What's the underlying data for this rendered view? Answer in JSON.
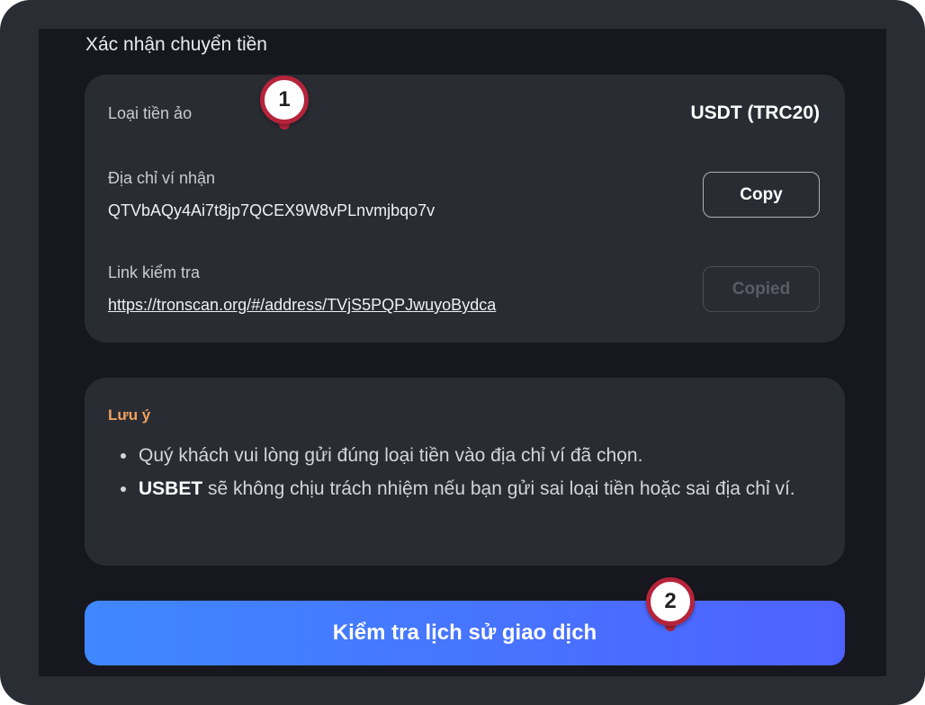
{
  "page": {
    "title": "Xác nhận chuyển tiền"
  },
  "transfer": {
    "coin_label": "Loại tiền ảo",
    "coin_value": "USDT (TRC20)",
    "address_label": "Địa chỉ ví nhận",
    "address_value": "QTVbAQy4Ai7t8jp7QCEX9W8vPLnvmjbqo7v",
    "copy_label": "Copy",
    "link_label": "Link kiểm tra",
    "link_value": "https://tronscan.org/#/address/TVjS5PQPJwuyoBydca",
    "copied_label": "Copied"
  },
  "note": {
    "title": "Lưu ý",
    "item1": "Quý khách vui lòng gửi đúng loại tiền vào địa chỉ ví đã chọn.",
    "item2_brand": "USBET",
    "item2_text": " sẽ không chịu trách nhiệm nếu bạn gửi sai loại tiền hoặc sai địa chỉ ví."
  },
  "primary_button": {
    "label": "Kiểm tra lịch sử giao dịch"
  },
  "markers": [
    "1",
    "2"
  ],
  "colors": {
    "accent_start": "#3f88ff",
    "accent_end": "#4e62ff",
    "note_title": "#f0a35e",
    "marker": "#b5243b"
  }
}
